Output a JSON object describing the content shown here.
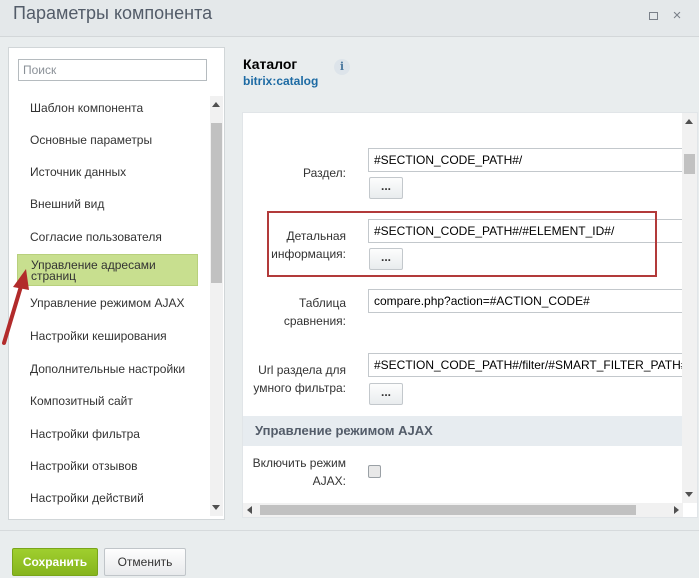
{
  "window": {
    "title": "Параметры компонента",
    "maximize_icon": "maximize-icon",
    "close_icon": "close-icon",
    "close_glyph": "×"
  },
  "sidebar": {
    "search_placeholder": "Поиск",
    "items": [
      {
        "label": "Шаблон компонента",
        "active": false
      },
      {
        "label": "Основные параметры",
        "active": false
      },
      {
        "label": "Источник данных",
        "active": false
      },
      {
        "label": "Внешний вид",
        "active": false
      },
      {
        "label": "Согласие пользователя",
        "active": false
      },
      {
        "label_line1": "Управление адресами",
        "label_line2": "страниц",
        "active": true
      },
      {
        "label": "Управление режимом AJAX",
        "active": false
      },
      {
        "label": "Настройки кеширования",
        "active": false
      },
      {
        "label": "Дополнительные настройки",
        "active": false
      },
      {
        "label": "Композитный сайт",
        "active": false
      },
      {
        "label": "Настройки фильтра",
        "active": false
      },
      {
        "label": "Настройки отзывов",
        "active": false
      },
      {
        "label": "Настройки действий",
        "active": false
      }
    ]
  },
  "component": {
    "title": "Каталог",
    "code": "bitrix:catalog",
    "info_glyph": "i"
  },
  "form": {
    "fields": [
      {
        "label": "Раздел:",
        "value": "#SECTION_CODE_PATH#/",
        "button": "..."
      },
      {
        "label_line1": "Детальная",
        "label_line2": "информация:",
        "value": "#SECTION_CODE_PATH#/#ELEMENT_ID#/",
        "button": "..."
      },
      {
        "label_line1": "Таблица",
        "label_line2": "сравнения:",
        "value": "compare.php?action=#ACTION_CODE#"
      },
      {
        "label_line1": "Url раздела для",
        "label_line2": "умного фильтра:",
        "value": "#SECTION_CODE_PATH#/filter/#SMART_FILTER_PATH#/apply/",
        "button": "..."
      }
    ],
    "section_ajax": "Управление режимом AJAX",
    "ajax_label_line1": "Включить режим",
    "ajax_label_line2": "AJAX:",
    "ajax_checked": false
  },
  "footer": {
    "save_label": "Сохранить",
    "cancel_label": "Отменить"
  },
  "colors": {
    "accent_green": "#8cbf22",
    "active_item": "#c8df8f",
    "highlight_red": "#b23a3a",
    "link_blue": "#1c6aa3"
  },
  "annotation": {
    "arrow_icon": "red-arrow-icon"
  }
}
